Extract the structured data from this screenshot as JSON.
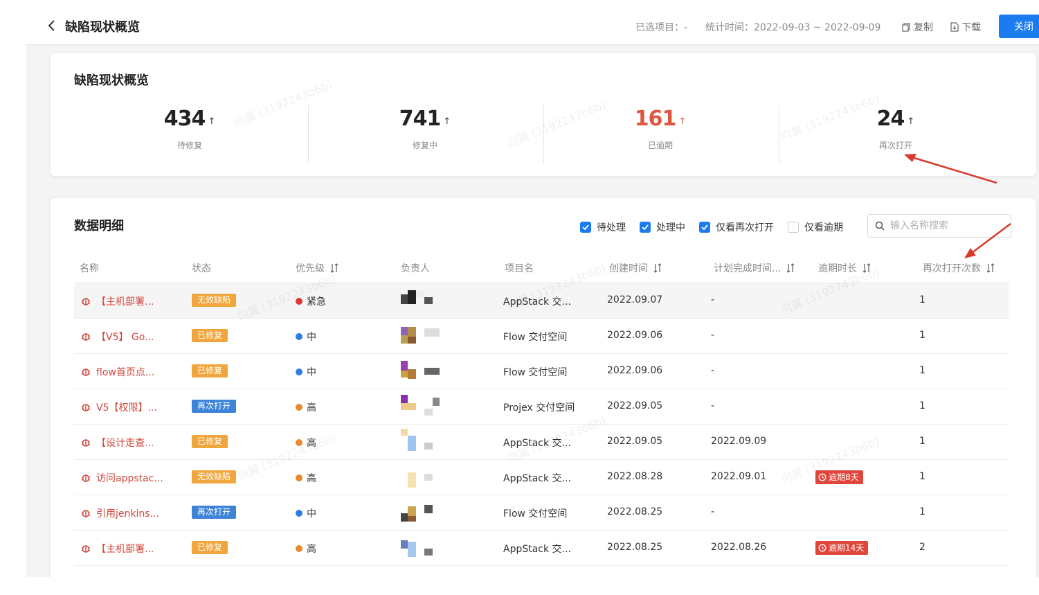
{
  "header": {
    "title": "缺陷现状概览",
    "selected_label": "已选项目：-",
    "stat_time": "统计时间：2022-09-03 ~ 2022-09-09",
    "copy_label": "复制",
    "download_label": "下载",
    "close_label": "关闭"
  },
  "summary": {
    "title": "缺陷现状概览",
    "stats": [
      {
        "value": "434",
        "label": "待修复",
        "color": "#222222"
      },
      {
        "value": "741",
        "label": "修复中",
        "color": "#222222"
      },
      {
        "value": "161",
        "label": "已逾期",
        "color": "#e0553d"
      },
      {
        "value": "24",
        "label": "再次打开",
        "color": "#222222"
      }
    ]
  },
  "detail": {
    "title": "数据明细",
    "filters": [
      {
        "label": "待处理",
        "checked": true
      },
      {
        "label": "处理中",
        "checked": true
      },
      {
        "label": "仅看再次打开",
        "checked": true
      },
      {
        "label": "仅看逾期",
        "checked": false
      }
    ],
    "search_placeholder": "输入名称搜索",
    "columns": [
      "名称",
      "状态",
      "优先级",
      "负责人",
      "项目名",
      "创建时间",
      "计划完成时间...",
      "逾期时长",
      "再次打开次数"
    ],
    "rows": [
      {
        "name": "【主机部署...",
        "status": "无效缺陷",
        "status_color": "orange",
        "priority": "紧急",
        "priority_color": "#d93b33",
        "project": "AppStack 交...",
        "created": "2022.09.07",
        "planned": "-",
        "overdue": "",
        "reopen": "1"
      },
      {
        "name": "【V5】 Go...",
        "status": "已修复",
        "status_color": "orange",
        "priority": "中",
        "priority_color": "#2f7de1",
        "project": "Flow 交付空间",
        "created": "2022.09.06",
        "planned": "-",
        "overdue": "",
        "reopen": "1"
      },
      {
        "name": "flow首页点...",
        "status": "已修复",
        "status_color": "orange",
        "priority": "中",
        "priority_color": "#2f7de1",
        "project": "Flow 交付空间",
        "created": "2022.09.06",
        "planned": "-",
        "overdue": "",
        "reopen": "1"
      },
      {
        "name": "V5【权限】...",
        "status": "再次打开",
        "status_color": "blue",
        "priority": "高",
        "priority_color": "#ea8a2e",
        "project": "Projex 交付空间",
        "created": "2022.09.05",
        "planned": "-",
        "overdue": "",
        "reopen": "1"
      },
      {
        "name": "【设计走查...",
        "status": "已修复",
        "status_color": "orange",
        "priority": "高",
        "priority_color": "#ea8a2e",
        "project": "AppStack 交...",
        "created": "2022.09.05",
        "planned": "2022.09.09",
        "overdue": "",
        "reopen": "1"
      },
      {
        "name": "访问appstac...",
        "status": "无效缺陷",
        "status_color": "orange",
        "priority": "高",
        "priority_color": "#ea8a2e",
        "project": "AppStack 交...",
        "created": "2022.08.28",
        "planned": "2022.09.01",
        "overdue": "逾期8天",
        "reopen": "1"
      },
      {
        "name": "引用jenkins...",
        "status": "再次打开",
        "status_color": "blue",
        "priority": "中",
        "priority_color": "#2f7de1",
        "project": "Flow 交付空间",
        "created": "2022.08.25",
        "planned": "-",
        "overdue": "",
        "reopen": "1"
      },
      {
        "name": "【主机部署...",
        "status": "已修复",
        "status_color": "orange",
        "priority": "高",
        "priority_color": "#ea8a2e",
        "project": "AppStack 交...",
        "created": "2022.08.25",
        "planned": "2022.08.26",
        "overdue": "逾期14天",
        "reopen": "2"
      }
    ]
  },
  "watermark_text": "向翼 (3192243b6b)",
  "annotation_color": "#d83a2c"
}
